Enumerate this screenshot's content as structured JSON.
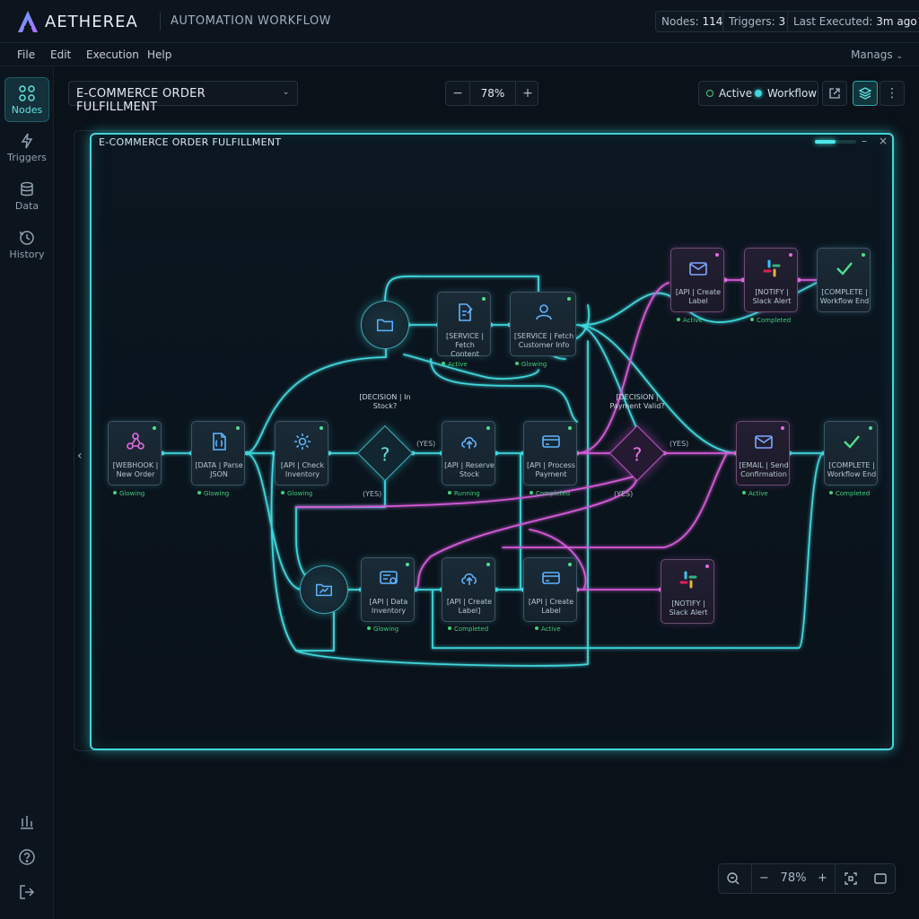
{
  "app": {
    "brand": "AETHEREA",
    "subtitle": "AUTOMATION WORKFLOW",
    "stats": [
      {
        "label": "Nodes:",
        "value": "114"
      },
      {
        "label": "Triggers:",
        "value": "3"
      },
      {
        "label": "Last Executed:",
        "value": "3m ago"
      }
    ]
  },
  "menu": {
    "items": [
      "File",
      "Edit",
      "Execution",
      "Help"
    ],
    "right": "Manags"
  },
  "sidebar": {
    "items": [
      {
        "label": "Nodes",
        "icon": "nodes-icon",
        "active": true
      },
      {
        "label": "Triggers",
        "icon": "lightning-icon",
        "active": false
      },
      {
        "label": "Data",
        "icon": "database-icon",
        "active": false
      },
      {
        "label": "History",
        "icon": "history-icon",
        "active": false
      }
    ],
    "bottom_icons": [
      "analytics-icon",
      "help-icon",
      "logout-icon"
    ]
  },
  "toolbar": {
    "workflow_name": "E-COMMERCE ORDER FULFILLMENT",
    "zoom": "78%",
    "zoom_minus": "−",
    "zoom_plus": "+",
    "status_active": "Active",
    "status_workflow": "Workflow",
    "more": "⋮"
  },
  "canvas": {
    "window_title": "E-COMMERCE ORDER FULFILLMENT",
    "progress": 0.5,
    "minimize": "–",
    "close": "×",
    "nav_left": "‹"
  },
  "nodes": {
    "webhook": {
      "label": "[WEBHOOK | New Order",
      "status": "Glowing"
    },
    "parse": {
      "label": "[DATA | Parse JSON",
      "status": "Glowing"
    },
    "check": {
      "label": "[API | Check Inventory",
      "status": "Glowing"
    },
    "reserve": {
      "label": "[API | Reserve Stock",
      "status": "Running"
    },
    "process": {
      "label": "[API | Process Payment",
      "status": "Completed"
    },
    "fetch_content": {
      "label": "[SERVICE | Fetch Content",
      "status": "Active"
    },
    "fetch_customer": {
      "label": "[SERVICE | Fetch Customer Info",
      "status": "Glowing"
    },
    "create_label_top": {
      "label": "[API | Create Label",
      "status": "Active"
    },
    "notify_top": {
      "label": "[NOTIFY | Slack Alert",
      "status": "Completed"
    },
    "complete_top": {
      "label": "[COMPLETE | Workflow End"
    },
    "email": {
      "label": "[EMAIL | Send Confirmation",
      "status": "Active"
    },
    "complete_mid": {
      "label": "[COMPLETE | Workflow End",
      "status": "Completed"
    },
    "data_inventory": {
      "label": "[API | Data Inventory",
      "status": "Glowing"
    },
    "create_label_1": {
      "label": "[API | Create Label]",
      "status": "Completed"
    },
    "create_label_2": {
      "label": "[API | Create Label",
      "status": "Active"
    },
    "notify_bottom": {
      "label": "[NOTIFY | Slack Alert"
    }
  },
  "decisions": {
    "stock": "[DECISION | In Stock?",
    "payment": "[DECISION | Payment Valid?"
  },
  "edge_labels": {
    "yes1": "(YES)",
    "yes2": "(YES)",
    "yes3": "(YES)",
    "yes4": "(YES)"
  },
  "bottom_bar": {
    "zoom": "78%",
    "minus": "−",
    "plus": "+"
  },
  "colors": {
    "accent_cyan": "#3fd6dc",
    "accent_pink": "#d65ad8",
    "status_green": "#3fd17a",
    "background": "#0a1119"
  }
}
